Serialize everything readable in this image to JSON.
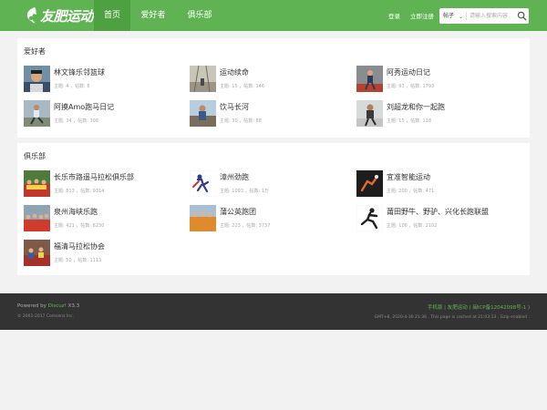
{
  "header": {
    "logo_text": "友肥运动",
    "nav": [
      "首页",
      "爱好者",
      "俱乐部"
    ],
    "login": "登录",
    "register": "立即注册",
    "search_select": "帖子",
    "search_placeholder": "请输入搜索内容"
  },
  "enthusiasts": {
    "title": "爱好者",
    "items": [
      {
        "name": "林文锋乐邻篮球",
        "meta": "主题: 4 ，帖数: 8"
      },
      {
        "name": "运动续命",
        "meta": "主题: 15 ，帖数: 146"
      },
      {
        "name": "阿秀运动日记",
        "meta": "主题: 93 ，帖数: 1793"
      },
      {
        "name": "阿摸Amo跑马日记",
        "meta": "主题: 34 ，帖数: 398"
      },
      {
        "name": "饮马长河",
        "meta": "主题: 30 ，帖数: 88"
      },
      {
        "name": "刘超龙和你一起跑",
        "meta": "主题: 15 ，帖数: 118"
      }
    ]
  },
  "clubs": {
    "title": "俱乐部",
    "items": [
      {
        "name": "长乐市路遥马拉松俱乐部",
        "meta": "主题: 813 ，帖数: 9314"
      },
      {
        "name": "漳州劲跑",
        "meta": "主题: 1093 ，帖数: 1万"
      },
      {
        "name": "宜准智能运动",
        "meta": "主题: 200 ，帖数: 471"
      },
      {
        "name": "泉州海峡乐跑",
        "meta": "主题: 421 ，帖数: 8230"
      },
      {
        "name": "蒲公英跑团",
        "meta": "主题: 223 ，帖数: 3737"
      },
      {
        "name": "莆田野牛、野驴、兴化长跑联盟",
        "meta": "主题: 106 ，帖数: 2102"
      },
      {
        "name": "福清马拉松协会",
        "meta": "主题: 50 ，帖数: 1113"
      }
    ]
  },
  "footer": {
    "powered_prefix": "Powered by ",
    "powered_name": "Discuz!",
    "powered_version": " X3.3",
    "copyright": "© 2001-2017 Comsenz Inc.",
    "links": "手机版 | 友肥运动 ( 闽ICP备12042098号-1 )",
    "info": "GMT+8, 2020-4-30 21:36 , This page is cached at 21:03:13 , Gzip enabled ."
  },
  "colors": {
    "brand_green": "#60b352",
    "nav_active": "#4ea141",
    "footer_bg": "#333333"
  }
}
